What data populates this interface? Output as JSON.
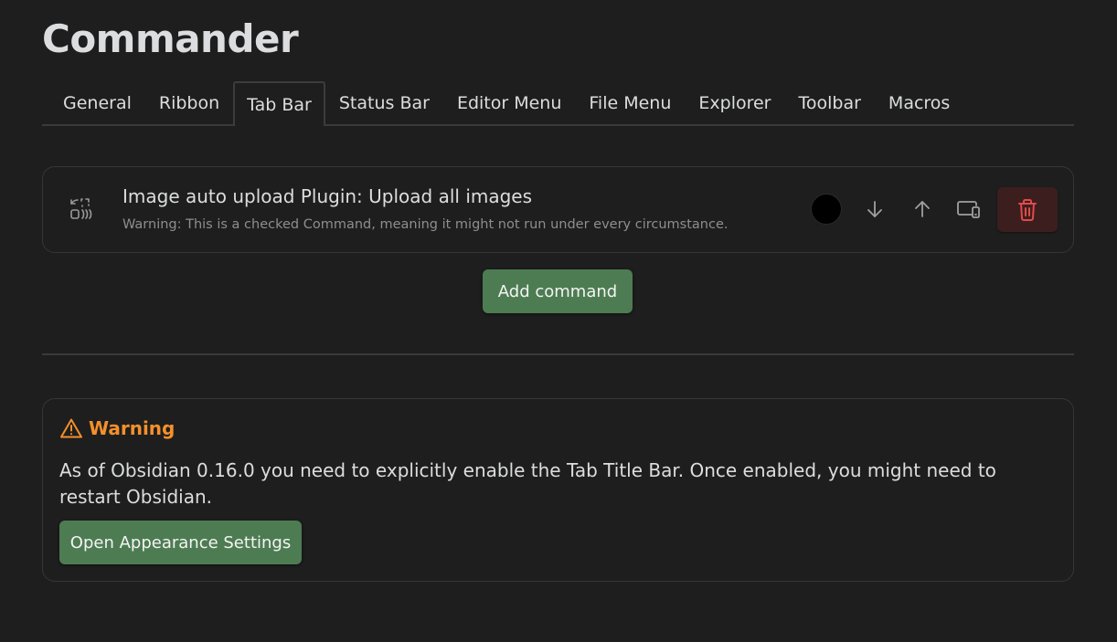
{
  "header": {
    "title": "Commander"
  },
  "tabs": [
    {
      "label": "General",
      "active": false
    },
    {
      "label": "Ribbon",
      "active": false
    },
    {
      "label": "Tab Bar",
      "active": true
    },
    {
      "label": "Status Bar",
      "active": false
    },
    {
      "label": "Editor Menu",
      "active": false
    },
    {
      "label": "File Menu",
      "active": false
    },
    {
      "label": "Explorer",
      "active": false
    },
    {
      "label": "Toolbar",
      "active": false
    },
    {
      "label": "Macros",
      "active": false
    }
  ],
  "command": {
    "icon": "image-upload-icon",
    "name": "Image auto upload Plugin: Upload all images",
    "description": "Warning: This is a checked Command, meaning it might not run under every circumstance.",
    "color": "#000000",
    "actions": [
      "move-down-icon",
      "move-up-icon",
      "device-mode-icon",
      "trash-icon"
    ]
  },
  "add_command_label": "Add command",
  "warning": {
    "icon": "warning-triangle-icon",
    "title": "Warning",
    "text": "As of Obsidian 0.16.0 you need to explicitly enable the Tab Title Bar. Once enabled, you might need to restart Obsidian.",
    "button_label": "Open Appearance Settings"
  },
  "colors": {
    "background": "#1e1e1e",
    "accent_green": "#4d7c52",
    "warning_orange": "#f3902c",
    "danger_red": "#e04a4a",
    "danger_bg": "#3d1e1e"
  }
}
